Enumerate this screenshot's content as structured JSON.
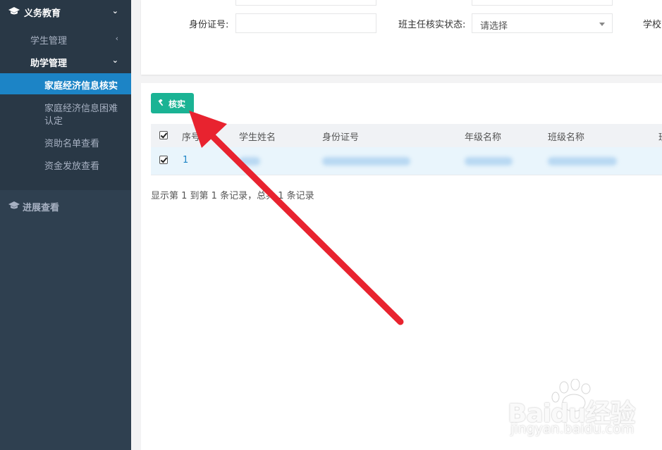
{
  "sidebar": {
    "section_title": "义务教育",
    "items": [
      {
        "label": "学生管理"
      },
      {
        "label": "助学管理"
      },
      {
        "label": "家庭经济信息核实"
      },
      {
        "label_line1": "家庭经济信息困难",
        "label_line2": "认定"
      },
      {
        "label": "资助名单查看"
      },
      {
        "label": "资金发放查看"
      }
    ],
    "section2_title": "进展查看"
  },
  "search": {
    "id_label": "身份证号:",
    "id_value": "",
    "teacher_status_label": "班主任核实状态:",
    "teacher_status_value": "请选择",
    "school_label": "学校"
  },
  "toolbar": {
    "verify_label": "核实"
  },
  "table": {
    "columns": [
      "序号",
      "学生姓名",
      "身份证号",
      "年级名称",
      "班级名称",
      "班"
    ],
    "rows": [
      {
        "index": "1"
      }
    ]
  },
  "pagination": {
    "summary": "显示第 1 到第 1 条记录，总共 1 条记录"
  },
  "watermark": {
    "text": "Baidu经验",
    "url": "jingyan.baidu.com"
  },
  "colors": {
    "sidebar_bg": "#2f4050",
    "active_item": "#1c84c6",
    "verify_button": "#1ab394",
    "arrow": "#e8232f"
  }
}
